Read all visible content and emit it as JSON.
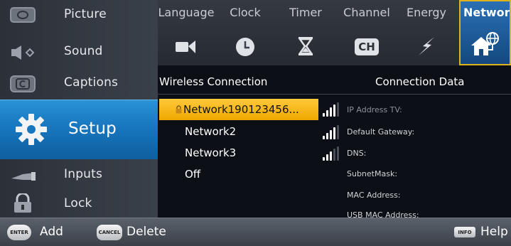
{
  "left_menu": {
    "items": [
      {
        "id": "picture",
        "label": "Picture",
        "icon": "picture-icon"
      },
      {
        "id": "sound",
        "label": "Sound",
        "icon": "speaker-icon"
      },
      {
        "id": "captions",
        "label": "Captions",
        "icon": "captions-icon"
      },
      {
        "id": "setup",
        "label": "Setup",
        "icon": "gear-icon",
        "selected": true
      },
      {
        "id": "inputs",
        "label": "Inputs",
        "icon": "cable-icon"
      },
      {
        "id": "lock",
        "label": "Lock",
        "icon": "padlock-icon"
      }
    ]
  },
  "tabs": [
    {
      "id": "language",
      "label": "Language",
      "icon": "language-icon"
    },
    {
      "id": "clock",
      "label": "Clock",
      "icon": "clock-icon"
    },
    {
      "id": "timer",
      "label": "Timer",
      "icon": "hourglass-icon"
    },
    {
      "id": "channel",
      "label": "Channel",
      "icon": "ch-icon",
      "icon_text": "CH"
    },
    {
      "id": "energy",
      "label": "Energy",
      "icon": "lightning-icon"
    },
    {
      "id": "network",
      "label": "Network",
      "icon": "home-network-icon",
      "selected": true
    }
  ],
  "content": {
    "wireless_header": "Wireless Connection",
    "connection_header": "Connection Data",
    "networks": [
      {
        "label": "Network190123456...",
        "secured": true,
        "signal_bars": 4,
        "selected": true
      },
      {
        "label": "Network2",
        "signal_bars": 4
      },
      {
        "label": "Network3",
        "signal_bars": 3
      },
      {
        "label": "Off"
      }
    ],
    "connection_fields": [
      "IP Address TV:",
      "Default Gateway:",
      "DNS:",
      "SubnetMask:",
      "MAC Address:",
      "USB MAC Address:"
    ]
  },
  "bottom_bar": {
    "enter_button": "ENTER",
    "add_label": "Add",
    "cancel_button": "CANCEL",
    "delete_label": "Delete",
    "info_button": "INFO",
    "help_label": "Help"
  },
  "colors": {
    "highlight": "#f0a800",
    "selected_blue": "#1877bf",
    "tab_border": "#e0b21c"
  }
}
